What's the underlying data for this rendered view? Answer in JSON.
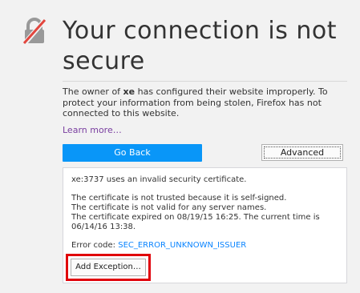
{
  "icon": {
    "name": "broken-lock-icon",
    "color": "#999999",
    "slash_color": "#e2463e"
  },
  "title": "Your connection is not secure",
  "description": {
    "before": "The owner of ",
    "site": "xe",
    "after": " has configured their website improperly. To protect your information from being stolen, Firefox has not connected to this website."
  },
  "learn_more": "Learn more…",
  "buttons": {
    "go_back": "Go Back",
    "advanced": "Advanced",
    "add_exception": "Add Exception…"
  },
  "details": {
    "summary": "xe:3737 uses an invalid security certificate.",
    "reasons": [
      "The certificate is not trusted because it is self-signed.",
      "The certificate is not valid for any server names.",
      "The certificate expired on 08/19/15 16:25. The current time is 06/14/16 13:38."
    ],
    "error_label": "Error code: ",
    "error_code": "SEC_ERROR_UNKNOWN_ISSUER"
  },
  "colors": {
    "accent_button": "#0996f8",
    "link_purple": "#7a3fa0",
    "link_blue": "#0a84ff",
    "highlight_red": "#e0000a"
  }
}
